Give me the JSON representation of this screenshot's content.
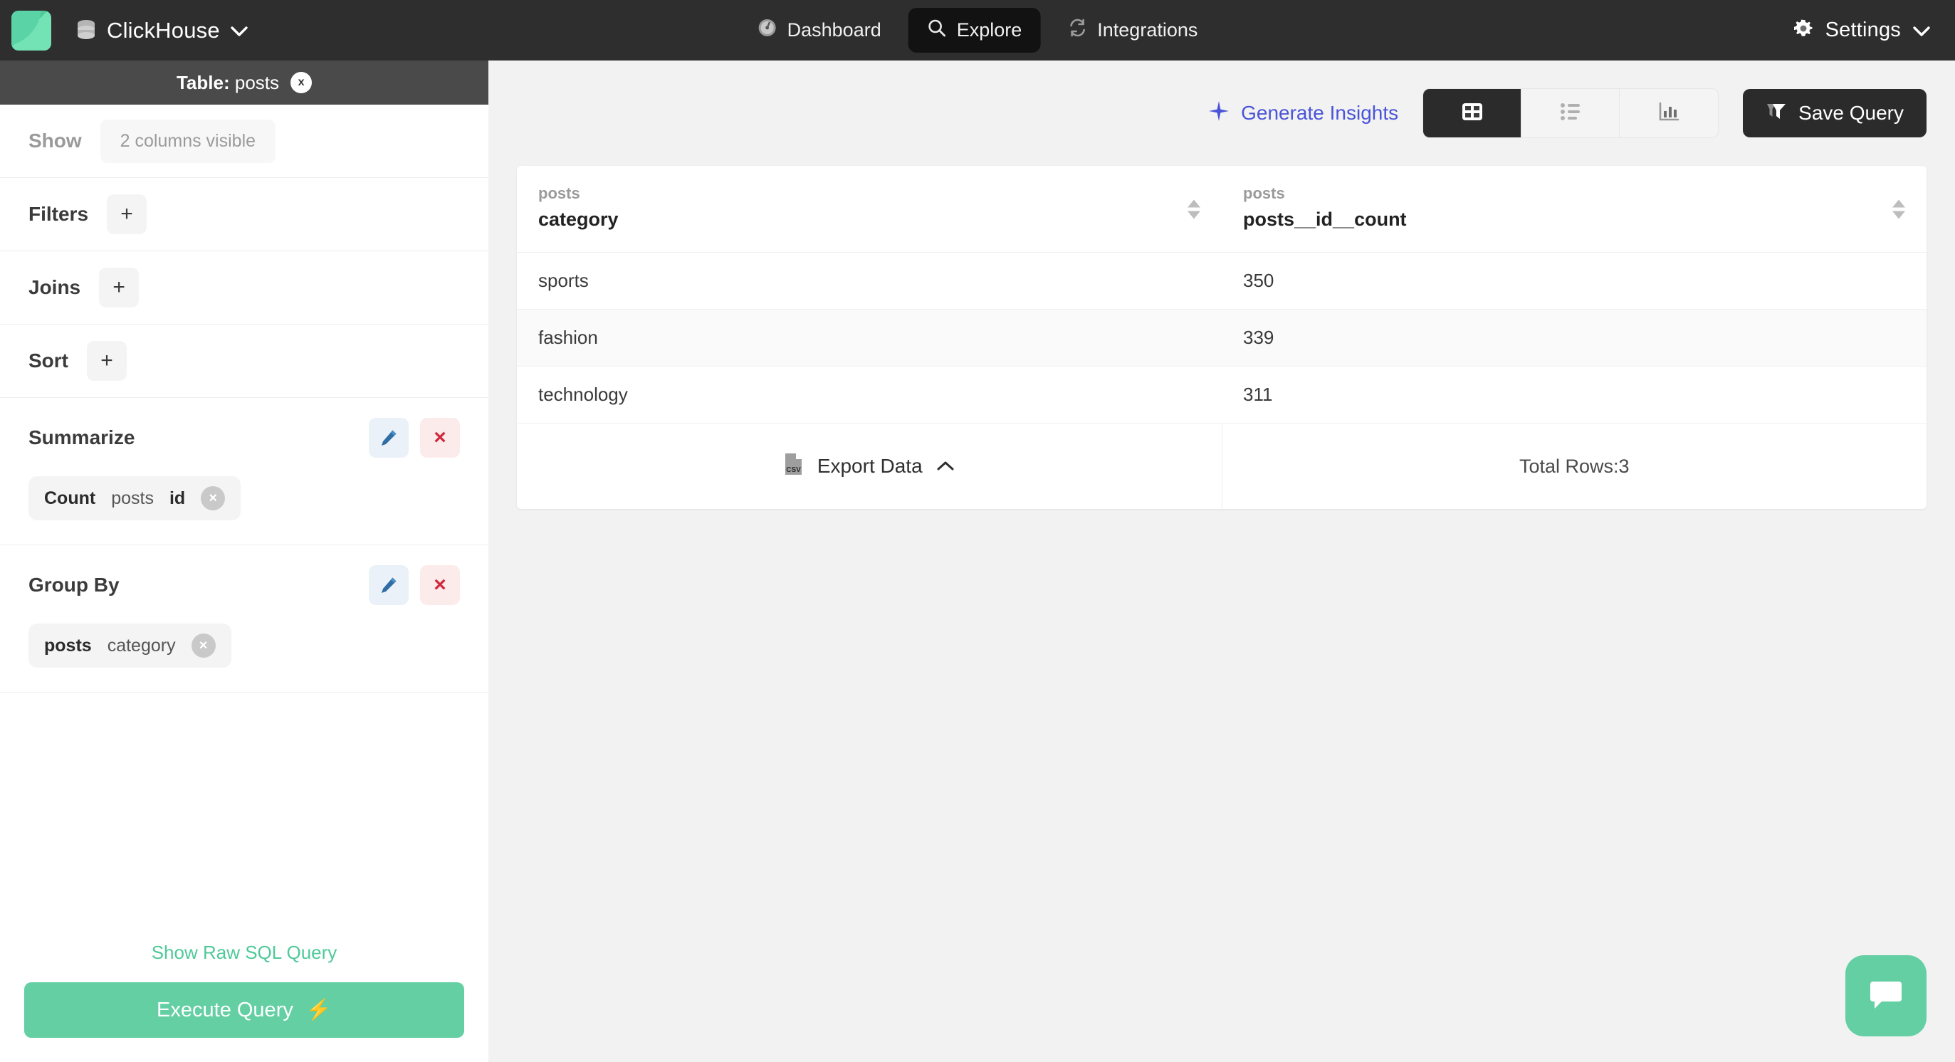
{
  "topnav": {
    "logo_icon": "app-logo",
    "database": {
      "icon": "database-icon",
      "label": "ClickHouse",
      "chevron": "∨"
    },
    "items": [
      {
        "icon": "dashboard-icon",
        "label": "Dashboard",
        "active": false
      },
      {
        "icon": "search-icon",
        "label": "Explore",
        "active": true
      },
      {
        "icon": "refresh-icon",
        "label": "Integrations",
        "active": false
      }
    ],
    "settings": {
      "icon": "gear-icon",
      "label": "Settings",
      "chevron": "∨"
    }
  },
  "sidebar": {
    "table_bar": {
      "prefix": "Table:",
      "table": "posts",
      "close": "x"
    },
    "show": {
      "label": "Show",
      "value": "2 columns visible"
    },
    "filters": {
      "label": "Filters",
      "add": "+"
    },
    "joins": {
      "label": "Joins",
      "add": "+"
    },
    "sort": {
      "label": "Sort",
      "add": "+"
    },
    "summarize": {
      "label": "Summarize",
      "edit": "edit-icon",
      "delete": "×",
      "chip": {
        "fn": "Count",
        "table": "posts",
        "column": "id",
        "remove": "×"
      }
    },
    "group_by": {
      "label": "Group By",
      "edit": "edit-icon",
      "delete": "×",
      "chip": {
        "table": "posts",
        "column": "category",
        "remove": "×"
      }
    },
    "raw_sql_link": "Show Raw SQL Query",
    "execute": {
      "label": "Execute Query",
      "icon": "⚡"
    }
  },
  "main": {
    "toolbar": {
      "generate_insights": {
        "icon": "sparkle-icon",
        "label": "Generate Insights"
      },
      "views": [
        {
          "name": "table-view",
          "icon": "table-icon",
          "active": true
        },
        {
          "name": "list-view",
          "icon": "list-icon",
          "active": false
        },
        {
          "name": "chart-view",
          "icon": "bar-chart-icon",
          "active": false
        }
      ],
      "save_query": {
        "icon": "funnel-icon",
        "label": "Save Query"
      }
    },
    "table": {
      "columns": [
        {
          "source": "posts",
          "name": "category"
        },
        {
          "source": "posts",
          "name": "posts__id__count"
        }
      ],
      "rows": [
        [
          "sports",
          "350"
        ],
        [
          "fashion",
          "339"
        ],
        [
          "technology",
          "311"
        ]
      ]
    },
    "footer": {
      "export": {
        "icon": "csv-file-icon",
        "label": "Export Data",
        "chevron": "⌃"
      },
      "total_rows": "Total Rows:3"
    },
    "chat_widget": "chat-bubble-icon"
  }
}
